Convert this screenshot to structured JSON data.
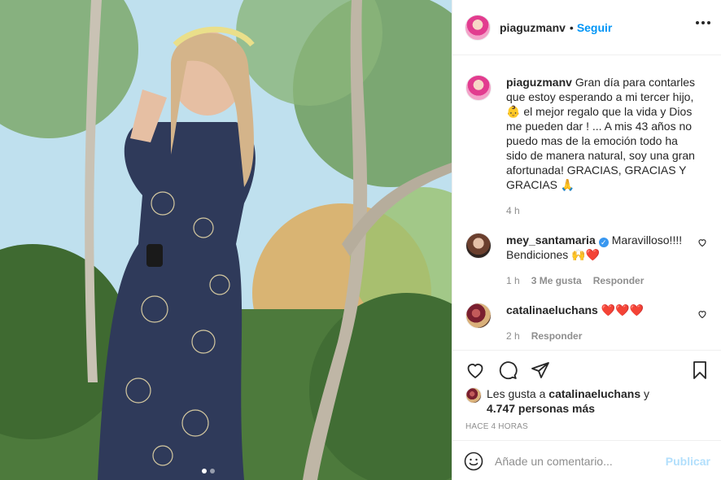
{
  "post": {
    "username": "piaguzmanv",
    "follow_label": "Seguir",
    "dot": "•",
    "caption": "Gran día para contarles que estoy esperando a mi tercer hijo, 👶 el mejor regalo que la vida y Dios me pueden dar ! ... A mis 43 años no puedo mas de la emoción todo ha sido de manera natural, soy una gran afortunada! GRACIAS, GRACIAS Y GRACIAS 🙏",
    "caption_age": "4 h"
  },
  "comments": [
    {
      "username": "mey_santamaria",
      "verified": true,
      "text": "Maravilloso!!!! Bendiciones 🙌❤️",
      "age": "1 h",
      "likes": "3 Me gusta",
      "reply_label": "Responder"
    },
    {
      "username": "catalinaeluchans",
      "verified": false,
      "text": "❤️❤️❤️",
      "age": "2 h",
      "reply_label": "Responder"
    }
  ],
  "likes": {
    "prefix": "Les gusta a",
    "user": "catalinaeluchans",
    "joiner": "y",
    "count": "4.747 personas más"
  },
  "timestamp": "Hace 4 horas",
  "comment_box": {
    "placeholder": "Añade un comentario...",
    "publish_label": "Publicar"
  },
  "icons": {
    "more": "more-options-icon",
    "like": "heart-icon",
    "comment": "comment-icon",
    "share": "paper-plane-icon",
    "save": "bookmark-icon",
    "emoji": "emoji-icon"
  },
  "colors": {
    "link_blue": "#0095f6",
    "publish_disabled": "#b2dffc",
    "muted_text": "#8e8e8e",
    "verified_blue": "#3897f0"
  },
  "carousel": {
    "total": 2,
    "active_index": 0
  }
}
